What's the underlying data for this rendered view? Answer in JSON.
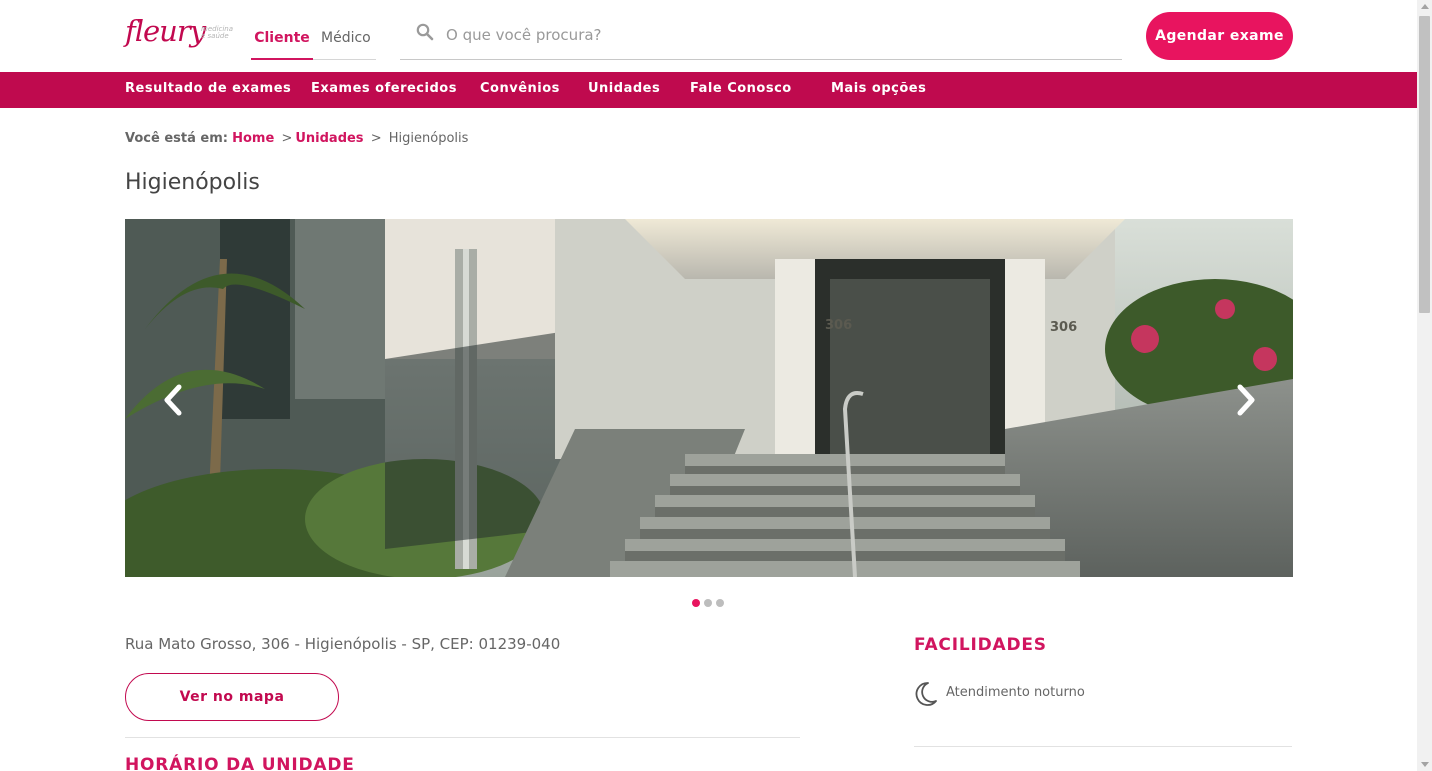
{
  "brand": {
    "logo_text": "fleury",
    "logo_tagline": "medicina e saúde",
    "accent": "#e8145f",
    "nav_bg": "#bf0a4e"
  },
  "header": {
    "audience_tabs": [
      {
        "label": "Cliente",
        "active": true
      },
      {
        "label": "Médico",
        "active": false
      }
    ],
    "search": {
      "placeholder": "O que você procura?",
      "value": "",
      "icon": "search-icon"
    },
    "cta_label": "Agendar exame"
  },
  "nav": {
    "items": [
      {
        "label": "Resultado de exames"
      },
      {
        "label": "Exames oferecidos"
      },
      {
        "label": "Convênios"
      },
      {
        "label": "Unidades"
      },
      {
        "label": "Fale Conosco"
      },
      {
        "label": "Mais opções"
      }
    ]
  },
  "breadcrumb": {
    "prefix": "Você está em:",
    "links": [
      {
        "label": "Home"
      },
      {
        "label": "Unidades"
      }
    ],
    "separator": ">",
    "current": "Higienópolis"
  },
  "page": {
    "title": "Higienópolis",
    "carousel": {
      "slide_count": 3,
      "active_index": 0,
      "prev_icon": "chevron-left-icon",
      "next_icon": "chevron-right-icon"
    },
    "address": "Rua Mato Grosso, 306 - Higienópolis - SP, CEP: 01239-040",
    "map_button": "Ver no mapa",
    "hours_title": "HORÁRIO DA UNIDADE"
  },
  "facilities": {
    "title": "FACILIDADES",
    "items": [
      {
        "label": "Atendimento noturno",
        "icon": "moon-icon"
      }
    ]
  }
}
